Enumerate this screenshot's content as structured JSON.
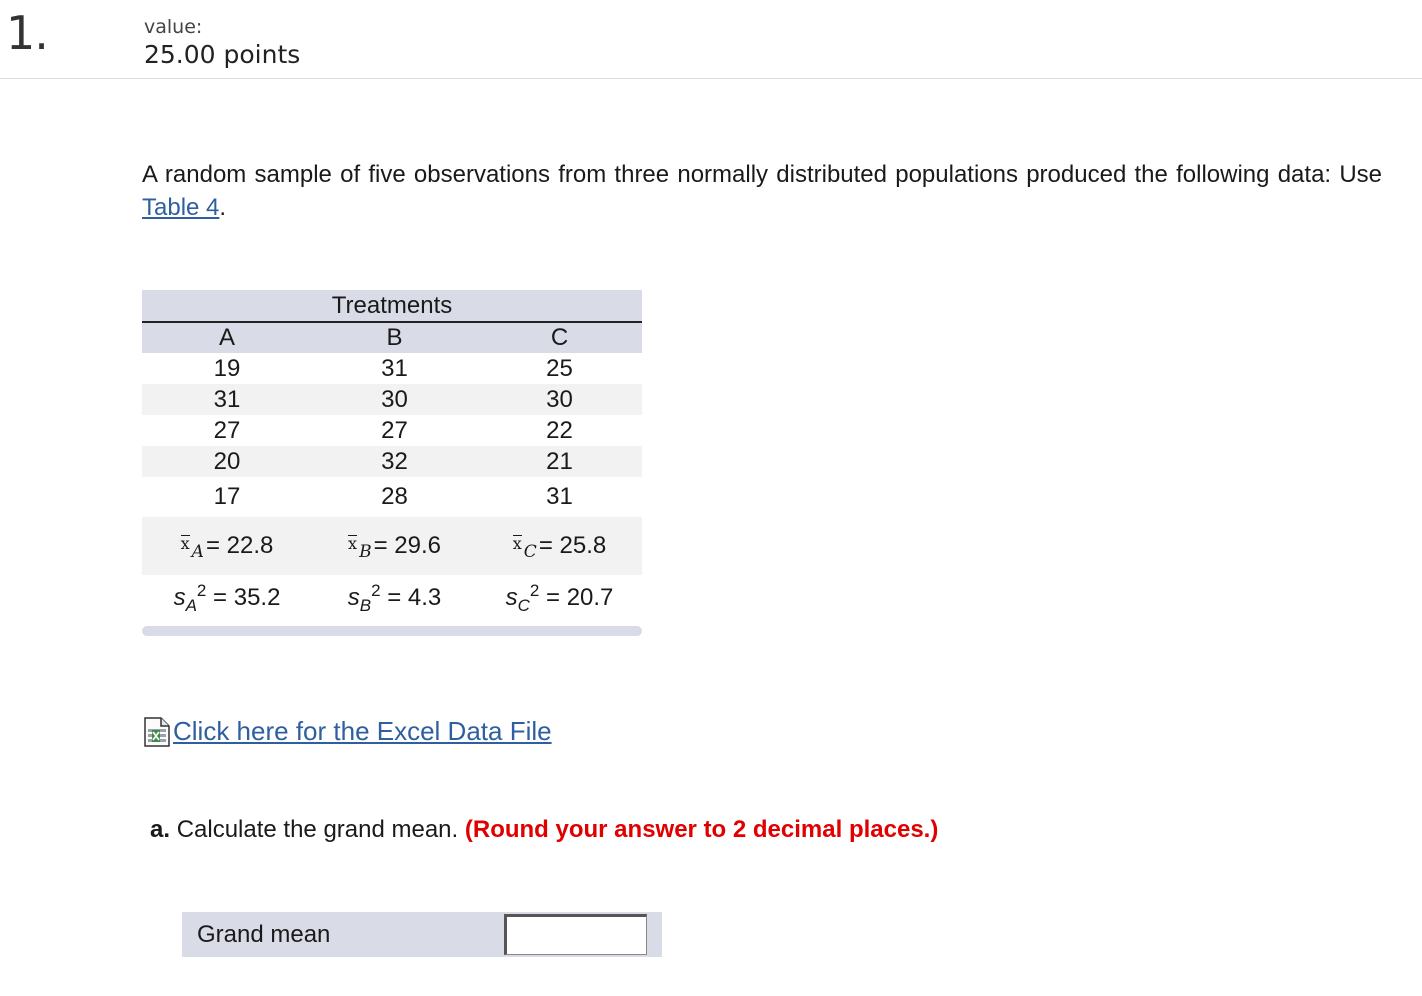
{
  "question": {
    "number": "1.",
    "value_label": "value:",
    "points": "25.00 points"
  },
  "prompt": {
    "text_before_link": "A random sample of five observations from three normally distributed populations produced the following data: Use ",
    "link_text": "Table 4",
    "text_after_link": "."
  },
  "table": {
    "caption": "Treatments",
    "columns": [
      "A",
      "B",
      "C"
    ],
    "rows": [
      [
        "19",
        "31",
        "25"
      ],
      [
        "31",
        "30",
        "30"
      ],
      [
        "27",
        "27",
        "22"
      ],
      [
        "20",
        "32",
        "21"
      ],
      [
        "17",
        "28",
        "31"
      ]
    ],
    "means": [
      {
        "symbol": "x",
        "group": "A",
        "value": "= 22.8"
      },
      {
        "symbol": "x",
        "group": "B",
        "value": "= 29.6"
      },
      {
        "symbol": "x",
        "group": "C",
        "value": "= 25.8"
      }
    ],
    "variances": [
      {
        "symbol": "s",
        "group": "A",
        "exp": "2",
        "value": " = 35.2"
      },
      {
        "symbol": "s",
        "group": "B",
        "exp": "2",
        "value": " = 4.3"
      },
      {
        "symbol": "s",
        "group": "C",
        "exp": "2",
        "value": " = 20.7"
      }
    ]
  },
  "excel": {
    "icon": "excel-file-icon",
    "link_text": "Click here for the Excel Data File"
  },
  "part_a": {
    "letter": "a.",
    "question": "Calculate the grand mean.",
    "note": "(Round your answer to 2 decimal places.)"
  },
  "answer": {
    "label": "Grand mean",
    "value": ""
  },
  "colors": {
    "link": "#2f5fa0",
    "note_red": "#e00000",
    "table_shade": "#d9dce6",
    "row_alt": "#f2f2f2"
  }
}
